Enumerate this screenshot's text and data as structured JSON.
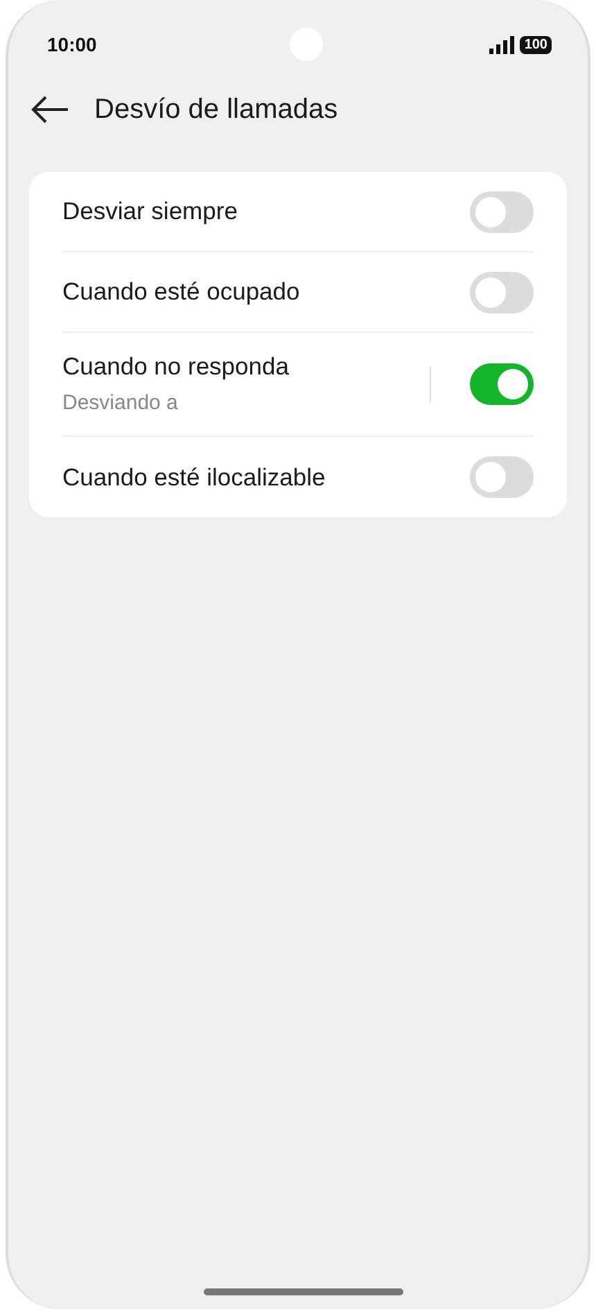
{
  "status_bar": {
    "time": "10:00",
    "battery": "100"
  },
  "header": {
    "title": "Desvío de llamadas"
  },
  "settings": [
    {
      "label": "Desviar siempre",
      "on": false
    },
    {
      "label": "Cuando esté ocupado",
      "on": false
    },
    {
      "label": "Cuando no responda",
      "subtitle": "Desviando a",
      "on": true
    },
    {
      "label": "Cuando esté ilocalizable",
      "on": false
    }
  ]
}
